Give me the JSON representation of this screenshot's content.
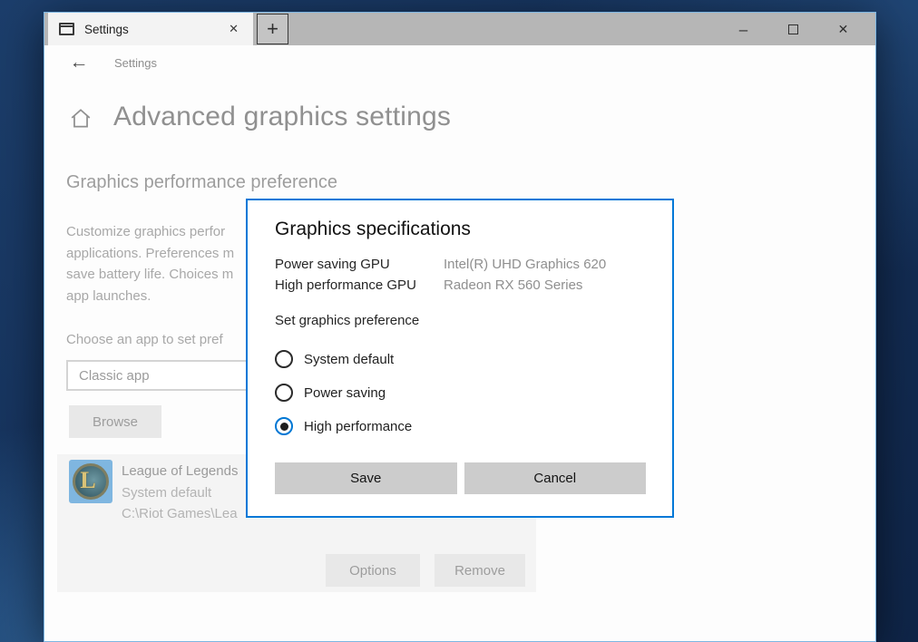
{
  "colors": {
    "accent": "#0078d7",
    "dialog_border": "#0078d7",
    "titlebar_gray": "#b6b6b6",
    "button_gray": "#cccccc",
    "desktop_navy": "#15315a"
  },
  "icons": {
    "tab_app": "settings-window",
    "tab_close": "✕",
    "new_tab": "+",
    "minimize": "–",
    "close": "✕",
    "back": "←",
    "home": "home-outline",
    "app_logo_letter": "L"
  },
  "tab_bar": {
    "tab_title": "Settings"
  },
  "nav": {
    "breadcrumb": "Settings"
  },
  "page": {
    "title": "Advanced graphics settings",
    "section_heading": "Graphics performance preference",
    "description_lines": [
      "Customize graphics perfor",
      "applications. Preferences m",
      "save battery life. Choices m",
      "app launches."
    ],
    "choose_app_label": "Choose an app to set pref",
    "app_type_value": "Classic app",
    "browse_label": "Browse",
    "app_item": {
      "name": "League of Legends",
      "preference": "System default",
      "path": "C:\\Riot Games\\Lea",
      "options_label": "Options",
      "remove_label": "Remove"
    }
  },
  "dialog": {
    "title": "Graphics specifications",
    "specs": [
      {
        "label": "Power saving GPU",
        "value": "Intel(R) UHD Graphics 620"
      },
      {
        "label": "High performance GPU",
        "value": "Radeon RX 560 Series"
      }
    ],
    "preference_label": "Set graphics preference",
    "options": [
      {
        "label": "System default",
        "selected": false
      },
      {
        "label": "Power saving",
        "selected": false
      },
      {
        "label": "High performance",
        "selected": true
      }
    ],
    "save_label": "Save",
    "cancel_label": "Cancel"
  }
}
